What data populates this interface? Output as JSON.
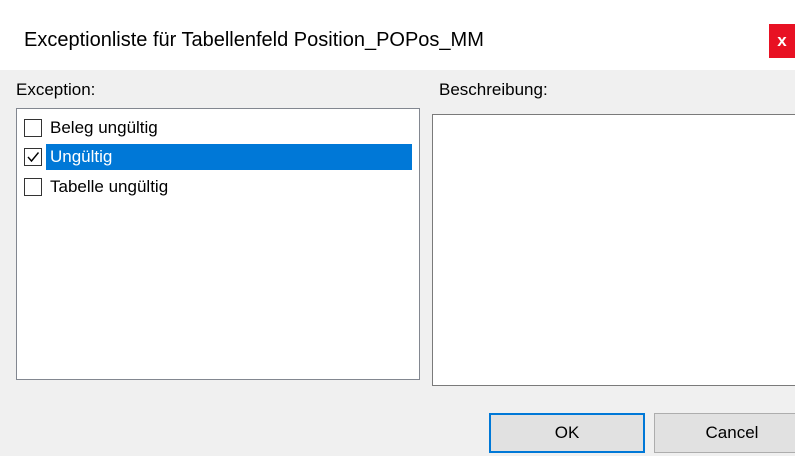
{
  "window": {
    "title": "Exceptionliste für Tabellenfeld Position_POPos_MM",
    "close_label": "x"
  },
  "exception_section": {
    "label": "Exception:",
    "items": [
      {
        "label": "Beleg ungültig",
        "checked": false,
        "selected": false
      },
      {
        "label": "Ungültig",
        "checked": true,
        "selected": true
      },
      {
        "label": "Tabelle ungültig",
        "checked": false,
        "selected": false
      }
    ]
  },
  "description_section": {
    "label": "Beschreibung:",
    "value": ""
  },
  "buttons": {
    "ok_label": "OK",
    "cancel_label": "Cancel"
  },
  "colors": {
    "selection": "#0078d7",
    "close_button": "#e81123",
    "dialog_background": "#f0f0f0"
  }
}
